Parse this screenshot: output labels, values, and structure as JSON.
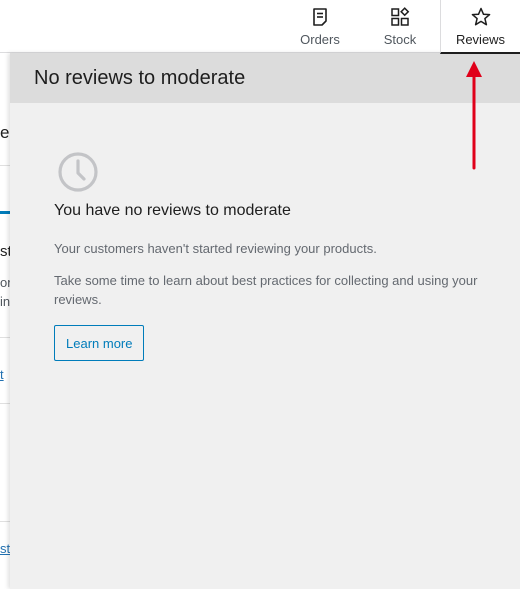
{
  "tabs": [
    {
      "label": "Orders",
      "icon": "document-icon"
    },
    {
      "label": "Stock",
      "icon": "shapes-icon"
    },
    {
      "label": "Reviews",
      "icon": "star-icon"
    }
  ],
  "background_fragments": {
    "a": "er",
    "b": "sta",
    "c": "or",
    "d": "in",
    "e": "t",
    "f": "st"
  },
  "panel": {
    "title": "No reviews to moderate",
    "icon": "clock-icon",
    "heading": "You have no reviews to moderate",
    "text1": "Your customers haven't started reviewing your products.",
    "text2": "Take some time to learn about best practices for collecting and using your reviews.",
    "button": "Learn more"
  },
  "colors": {
    "accent": "#007cba",
    "annotation": "#e0001a",
    "panel_bg": "#f0f0f0",
    "panel_header_bg": "#dcdcdc"
  }
}
